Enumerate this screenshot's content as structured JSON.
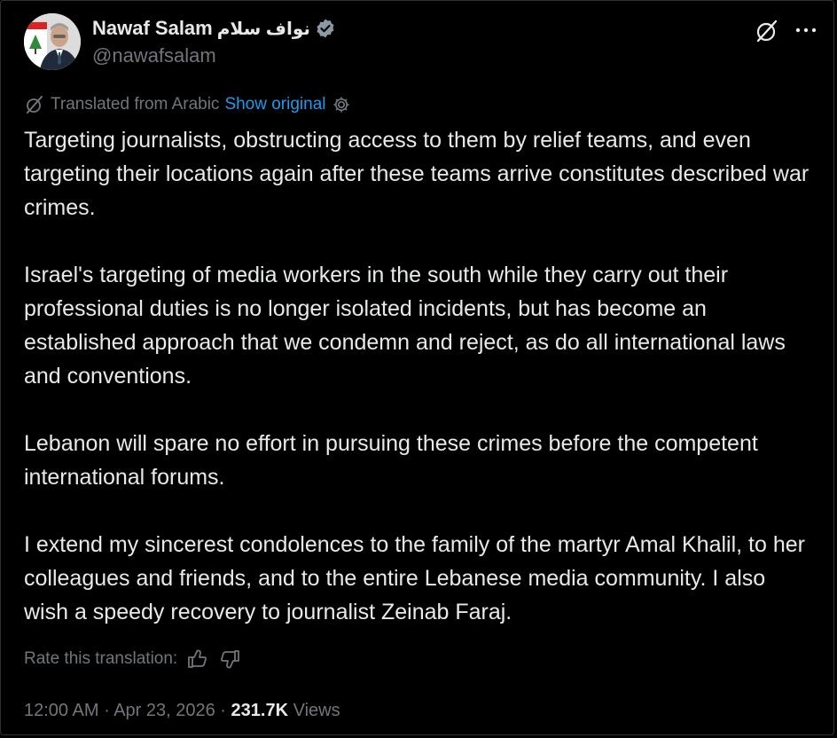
{
  "author": {
    "display_name": "Nawaf Salam",
    "arabic_name": "نواف سلام",
    "handle": "@nawafsalam",
    "verified_color": "#8b98a5",
    "avatar_icon": "avatar-photo-with-flag"
  },
  "header_actions": {
    "grok_icon": "grok-icon",
    "more_icon": "more-dots-icon"
  },
  "translation": {
    "label": "Translated from Arabic",
    "show_original": "Show original",
    "settings_icon": "gear-icon",
    "link_color": "#1d9bf0"
  },
  "tweet": {
    "paragraphs": [
      "Targeting journalists, obstructing access to them by relief teams, and even targeting their locations again after these teams arrive constitutes described war crimes.",
      "Israel's targeting of media workers in the south while they carry out their professional duties is no longer isolated incidents, but has become an established approach that we condemn and reject, as do all international laws and conventions.",
      "Lebanon will spare no effort in pursuing these crimes before the competent international forums.",
      "I extend my sincerest condolences to the family of the martyr Amal Khalil, to her colleagues and friends, and to the entire Lebanese media community. I also wish a speedy recovery to journalist Zeinab Faraj."
    ]
  },
  "rate": {
    "label": "Rate this translation:",
    "thumbs_up_icon": "thumbs-up-icon",
    "thumbs_down_icon": "thumbs-down-icon"
  },
  "meta": {
    "time": "12:00 AM",
    "separator": "·",
    "date": "Apr 23, 2026",
    "views_count": "231.7K",
    "views_label": "Views"
  }
}
